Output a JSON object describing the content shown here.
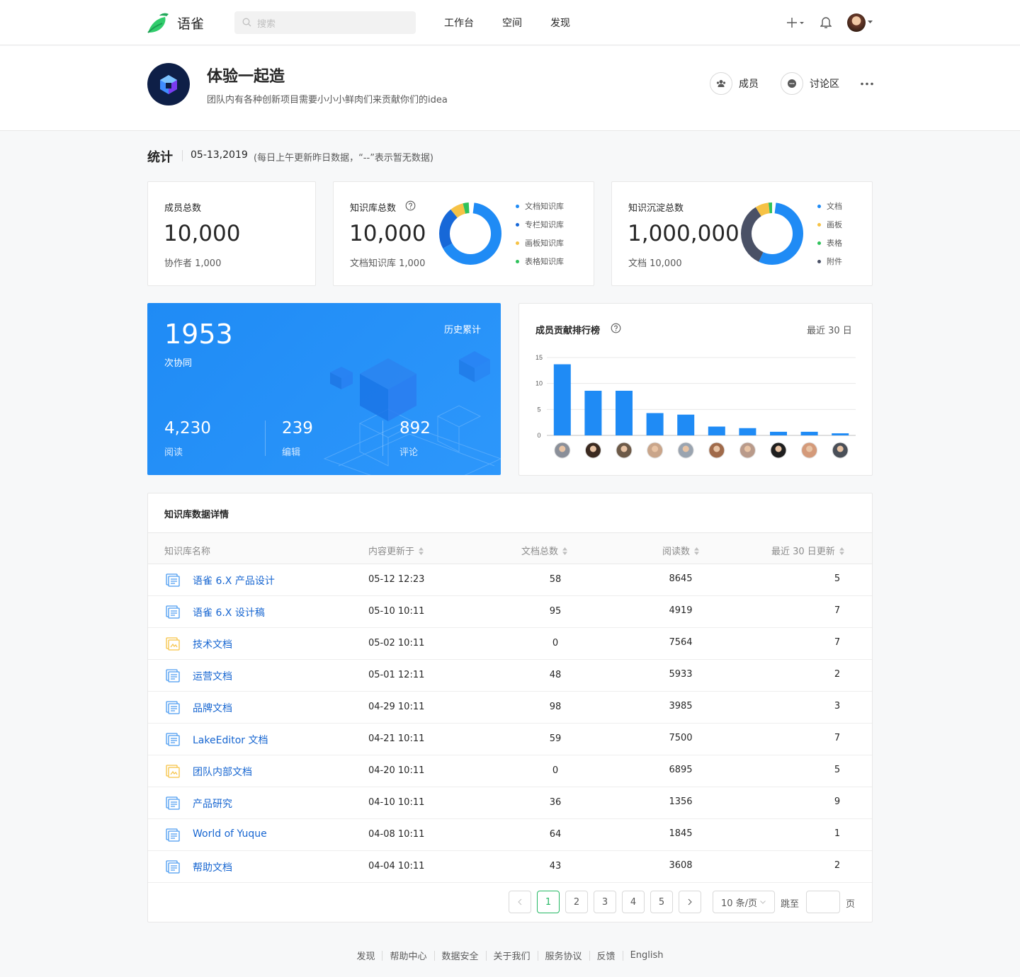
{
  "nav": {
    "brand": "语雀",
    "search_placeholder": "搜索",
    "links": [
      "工作台",
      "空间",
      "发现"
    ]
  },
  "group": {
    "title": "体验一起造",
    "description": "团队内有各种创新项目需要小小小鲜肉们来贡献你们的idea",
    "members_label": "成员",
    "discussion_label": "讨论区"
  },
  "stats": {
    "title": "统计",
    "date": "05-13,2019",
    "note": "(每日上午更新昨日数据，“--”表示暂无数据)",
    "members": {
      "label": "成员总数",
      "value": "10,000",
      "sub": "协作者 1,000"
    },
    "repos": {
      "label": "知识库总数",
      "value": "10,000",
      "sub": "文档知识库 1,000",
      "legend": [
        "文档知识库",
        "专栏知识库",
        "画板知识库",
        "表格知识库"
      ]
    },
    "docs": {
      "label": "知识沉淀总数",
      "value": "1,000,000",
      "sub": "文档 10,000",
      "legend": [
        "文档",
        "画板",
        "表格",
        "附件"
      ]
    }
  },
  "colors": {
    "primary": "#1f8bf5",
    "dark_blue": "#1768d8",
    "yellow": "#f6c245",
    "green": "#2fc25b",
    "slate": "#4a5166",
    "link": "#1766d1"
  },
  "collab": {
    "count": "1953",
    "count_label": "次协同",
    "history_label": "历史累计",
    "reads": "4,230",
    "reads_label": "阅读",
    "edits": "239",
    "edits_label": "编辑",
    "comments": "892",
    "comments_label": "评论"
  },
  "ranking": {
    "title": "成员贡献排行榜",
    "period": "最近 30 日"
  },
  "chart_data": {
    "type": "bar",
    "title": "成员贡献排行榜",
    "ylim": [
      0,
      15
    ],
    "yticks": [
      "15",
      "10",
      "5",
      "0"
    ],
    "values": [
      13.7,
      8.6,
      8.6,
      4.3,
      4,
      1.7,
      1.4,
      0.7,
      0.7,
      0.4
    ],
    "grid": true
  },
  "donut_repos": [
    0.65,
    0.22,
    0.07,
    0.03
  ],
  "donut_docs": [
    0.55,
    0.34,
    0.07,
    0.04
  ],
  "table": {
    "title": "知识库数据详情",
    "headers": [
      "知识库名称",
      "内容更新于",
      "文档总数",
      "阅读数",
      "最近 30 日更新"
    ],
    "rows": [
      {
        "name": "语雀 6.X 产品设计",
        "updated": "05-12 12:23",
        "docs": "58",
        "reads": "8645",
        "recent": "5",
        "icon": "doc-book-icon"
      },
      {
        "name": "语雀 6.X 设计稿",
        "updated": "05-10 10:11",
        "docs": "95",
        "reads": "4919",
        "recent": "7",
        "icon": "doc-book-icon"
      },
      {
        "name": "技术文档",
        "updated": "05-02 10:11",
        "docs": "0",
        "reads": "7564",
        "recent": "7",
        "icon": "board-book-icon"
      },
      {
        "name": "运营文档",
        "updated": "05-01 12:11",
        "docs": "48",
        "reads": "5933",
        "recent": "2",
        "icon": "doc-book-icon"
      },
      {
        "name": "品牌文档",
        "updated": "04-29 10:11",
        "docs": "98",
        "reads": "3985",
        "recent": "3",
        "icon": "doc-book-icon"
      },
      {
        "name": "LakeEditor 文档",
        "updated": "04-21 10:11",
        "docs": "59",
        "reads": "7500",
        "recent": "7",
        "icon": "doc-book-icon"
      },
      {
        "name": "团队内部文档",
        "updated": "04-20 10:11",
        "docs": "0",
        "reads": "6895",
        "recent": "5",
        "icon": "board-book-icon"
      },
      {
        "name": "产品研究",
        "updated": "04-10 10:11",
        "docs": "36",
        "reads": "1356",
        "recent": "9",
        "icon": "doc-book-icon"
      },
      {
        "name": "World of Yuque",
        "updated": "04-08 10:11",
        "docs": "64",
        "reads": "1845",
        "recent": "1",
        "icon": "doc-book-icon"
      },
      {
        "name": "帮助文档",
        "updated": "04-04 10:11",
        "docs": "43",
        "reads": "3608",
        "recent": "2",
        "icon": "doc-book-icon"
      }
    ]
  },
  "pagination": {
    "pages": [
      "1",
      "2",
      "3",
      "4",
      "5"
    ],
    "current": "1",
    "page_size": "10 条/页",
    "jump_label": "跳至",
    "page_suffix": "页"
  },
  "footer": [
    "发现",
    "帮助中心",
    "数据安全",
    "关于我们",
    "服务协议",
    "反馈",
    "English"
  ]
}
